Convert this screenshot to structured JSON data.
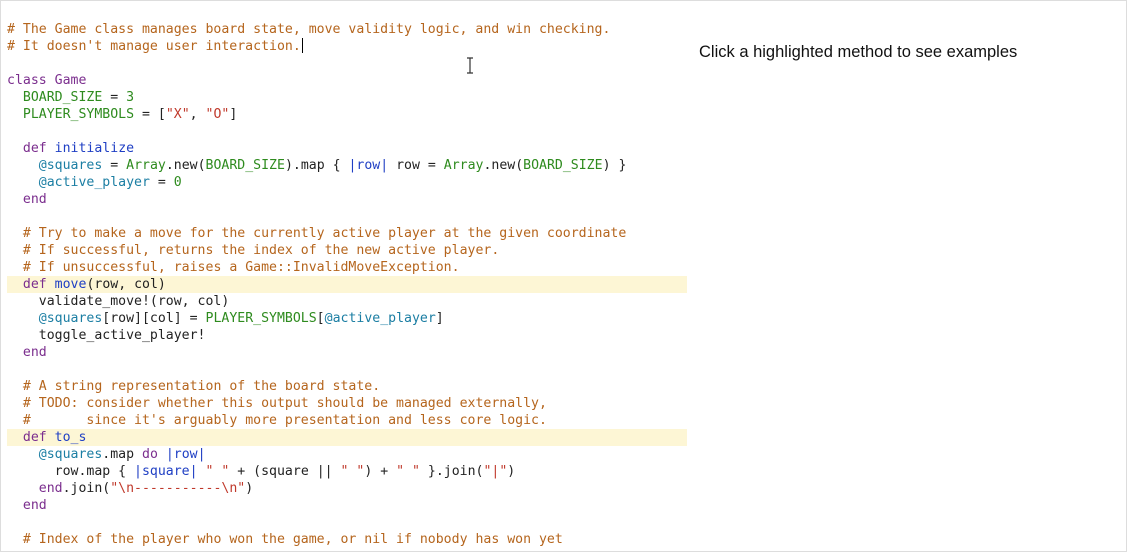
{
  "side_panel": {
    "hint": "Click a highlighted method to see examples"
  },
  "icons": {
    "cursor": "text-cursor-icon"
  },
  "colors": {
    "comment": "#b5651d",
    "keyword": "#7b2e8e",
    "method_name": "#1f3fc4",
    "constant": "#2e8b1e",
    "ivar": "#1b7ea3",
    "string": "#c0392b",
    "highlight_bg": "#fdf6d5"
  },
  "code_lines": [
    {
      "hl": false,
      "tokens": [
        [
          "c",
          "# The Game class manages board state, move validity logic, and win checking."
        ]
      ]
    },
    {
      "hl": false,
      "caret": true,
      "tokens": [
        [
          "c",
          "# It doesn't manage user interaction."
        ]
      ]
    },
    {
      "hl": false,
      "tokens": []
    },
    {
      "hl": false,
      "tokens": [
        [
          "k",
          "class"
        ],
        [
          "",
          " "
        ],
        [
          "k",
          "Game"
        ]
      ]
    },
    {
      "hl": false,
      "tokens": [
        [
          "",
          "  "
        ],
        [
          "con",
          "BOARD_SIZE"
        ],
        [
          "",
          " = "
        ],
        [
          "num",
          "3"
        ]
      ]
    },
    {
      "hl": false,
      "tokens": [
        [
          "",
          "  "
        ],
        [
          "con",
          "PLAYER_SYMBOLS"
        ],
        [
          "",
          " = ["
        ],
        [
          "s",
          "\"X\""
        ],
        [
          "",
          ", "
        ],
        [
          "s",
          "\"O\""
        ],
        [
          "",
          "]"
        ]
      ]
    },
    {
      "hl": false,
      "tokens": []
    },
    {
      "hl": false,
      "tokens": [
        [
          "",
          "  "
        ],
        [
          "k",
          "def"
        ],
        [
          "",
          " "
        ],
        [
          "fn",
          "initialize"
        ]
      ]
    },
    {
      "hl": false,
      "tokens": [
        [
          "",
          "    "
        ],
        [
          "iv",
          "@squares"
        ],
        [
          "",
          " = "
        ],
        [
          "con",
          "Array"
        ],
        [
          "",
          ".new("
        ],
        [
          "con",
          "BOARD_SIZE"
        ],
        [
          "",
          ").map { "
        ],
        [
          "bar",
          "|row|"
        ],
        [
          "",
          " row = "
        ],
        [
          "con",
          "Array"
        ],
        [
          "",
          ".new("
        ],
        [
          "con",
          "BOARD_SIZE"
        ],
        [
          "",
          ") }"
        ]
      ]
    },
    {
      "hl": false,
      "tokens": [
        [
          "",
          "    "
        ],
        [
          "iv",
          "@active_player"
        ],
        [
          "",
          " = "
        ],
        [
          "num",
          "0"
        ]
      ]
    },
    {
      "hl": false,
      "tokens": [
        [
          "",
          "  "
        ],
        [
          "k",
          "end"
        ]
      ]
    },
    {
      "hl": false,
      "tokens": []
    },
    {
      "hl": false,
      "tokens": [
        [
          "",
          "  "
        ],
        [
          "c",
          "# Try to make a move for the currently active player at the given coordinate"
        ]
      ]
    },
    {
      "hl": false,
      "tokens": [
        [
          "",
          "  "
        ],
        [
          "c",
          "# If successful, returns the index of the new active player."
        ]
      ]
    },
    {
      "hl": false,
      "tokens": [
        [
          "",
          "  "
        ],
        [
          "c",
          "# If unsuccessful, raises a Game::InvalidMoveException."
        ]
      ]
    },
    {
      "hl": true,
      "tokens": [
        [
          "",
          "  "
        ],
        [
          "k",
          "def"
        ],
        [
          "",
          " "
        ],
        [
          "fn",
          "move"
        ],
        [
          "",
          "(row, col)"
        ]
      ]
    },
    {
      "hl": false,
      "tokens": [
        [
          "",
          "    validate_move!(row, col)"
        ]
      ]
    },
    {
      "hl": false,
      "tokens": [
        [
          "",
          "    "
        ],
        [
          "iv",
          "@squares"
        ],
        [
          "",
          "[row][col] = "
        ],
        [
          "con",
          "PLAYER_SYMBOLS"
        ],
        [
          "",
          "["
        ],
        [
          "iv",
          "@active_player"
        ],
        [
          "",
          "]"
        ]
      ]
    },
    {
      "hl": false,
      "tokens": [
        [
          "",
          "    toggle_active_player!"
        ]
      ]
    },
    {
      "hl": false,
      "tokens": [
        [
          "",
          "  "
        ],
        [
          "k",
          "end"
        ]
      ]
    },
    {
      "hl": false,
      "tokens": []
    },
    {
      "hl": false,
      "tokens": [
        [
          "",
          "  "
        ],
        [
          "c",
          "# A string representation of the board state."
        ]
      ]
    },
    {
      "hl": false,
      "tokens": [
        [
          "",
          "  "
        ],
        [
          "c",
          "# TODO: consider whether this output should be managed externally,"
        ]
      ]
    },
    {
      "hl": false,
      "tokens": [
        [
          "",
          "  "
        ],
        [
          "c",
          "#       since it's arguably more presentation and less core logic."
        ]
      ]
    },
    {
      "hl": true,
      "tokens": [
        [
          "",
          "  "
        ],
        [
          "k",
          "def"
        ],
        [
          "",
          " "
        ],
        [
          "fn",
          "to_s"
        ]
      ]
    },
    {
      "hl": false,
      "tokens": [
        [
          "",
          "    "
        ],
        [
          "iv",
          "@squares"
        ],
        [
          "",
          ".map "
        ],
        [
          "k",
          "do"
        ],
        [
          "",
          " "
        ],
        [
          "bar",
          "|row|"
        ]
      ]
    },
    {
      "hl": false,
      "tokens": [
        [
          "",
          "      row.map { "
        ],
        [
          "bar",
          "|square|"
        ],
        [
          "",
          " "
        ],
        [
          "s",
          "\" \""
        ],
        [
          "",
          " + (square || "
        ],
        [
          "s",
          "\" \""
        ],
        [
          "",
          ") + "
        ],
        [
          "s",
          "\" \""
        ],
        [
          "",
          " }.join("
        ],
        [
          "s",
          "\"|\""
        ],
        [
          "",
          ")"
        ]
      ]
    },
    {
      "hl": false,
      "tokens": [
        [
          "",
          "    "
        ],
        [
          "k",
          "end"
        ],
        [
          "",
          ".join("
        ],
        [
          "s",
          "\"\\n-----------\\n\""
        ],
        [
          "",
          ")"
        ]
      ]
    },
    {
      "hl": false,
      "tokens": [
        [
          "",
          "  "
        ],
        [
          "k",
          "end"
        ]
      ]
    },
    {
      "hl": false,
      "tokens": []
    },
    {
      "hl": false,
      "tokens": [
        [
          "",
          "  "
        ],
        [
          "c",
          "# Index of the player who won the game, or nil if nobody has won yet"
        ]
      ]
    }
  ]
}
